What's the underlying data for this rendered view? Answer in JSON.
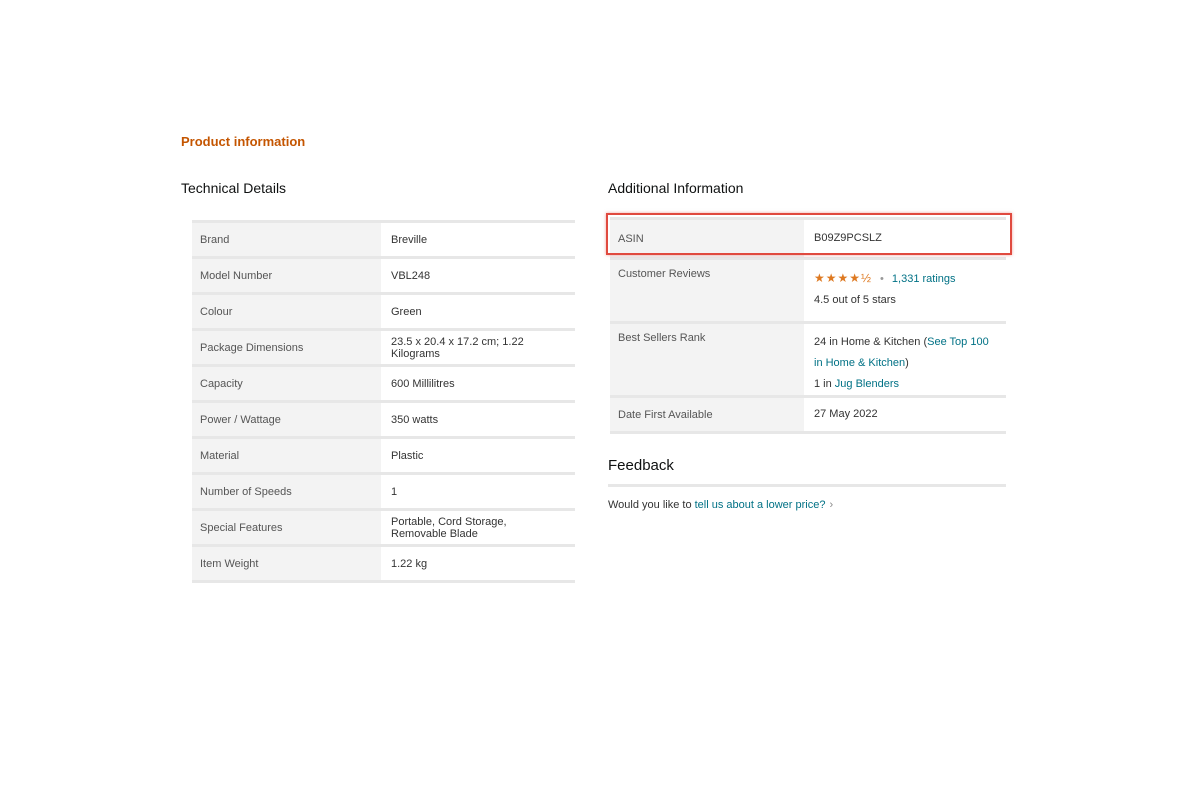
{
  "section_title": "Product information",
  "technical_details": {
    "heading": "Technical Details",
    "rows": [
      {
        "label": "Brand",
        "value": "Breville"
      },
      {
        "label": "Model Number",
        "value": "VBL248"
      },
      {
        "label": "Colour",
        "value": "Green"
      },
      {
        "label": "Package Dimensions",
        "value": "23.5 x 20.4 x 17.2 cm; 1.22 Kilograms"
      },
      {
        "label": "Capacity",
        "value": "600 Millilitres"
      },
      {
        "label": "Power / Wattage",
        "value": "350 watts"
      },
      {
        "label": "Material",
        "value": "Plastic"
      },
      {
        "label": "Number of Speeds",
        "value": "1"
      },
      {
        "label": "Special Features",
        "value": "Portable, Cord Storage, Removable Blade"
      },
      {
        "label": "Item Weight",
        "value": "1.22 kg"
      }
    ]
  },
  "additional_information": {
    "heading": "Additional Information",
    "asin": {
      "label": "ASIN",
      "value": "B09Z9PCSLZ"
    },
    "customer_reviews": {
      "label": "Customer Reviews",
      "stars_glyph": "★★★★½",
      "rating_fraction": 0.9,
      "ratings_link": "1,331 ratings",
      "rating_text": "4.5 out of 5 stars"
    },
    "best_sellers_rank": {
      "label": "Best Sellers Rank",
      "rank_text": "24 in Home & Kitchen (",
      "see_top_link": "See Top 100 in Home & Kitchen",
      "rank_close": ")",
      "sub_rank_prefix": "1 in ",
      "sub_rank_link": "Jug Blenders"
    },
    "date_first_available": {
      "label": "Date First Available",
      "value": "27 May 2022"
    }
  },
  "feedback": {
    "heading": "Feedback",
    "prompt": "Would you like to ",
    "link": "tell us about a lower price?",
    "chevron": "›"
  },
  "colors": {
    "accent": "#c45500",
    "link": "#007185",
    "star": "#de7921",
    "highlight": "#e04a3f"
  }
}
